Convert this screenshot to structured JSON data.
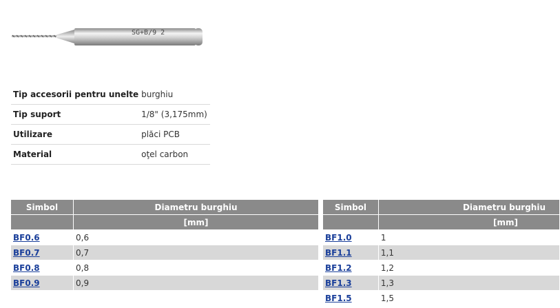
{
  "product": {
    "image_icon": "drill-bit-image",
    "image_engraving": "SG+B/9 2"
  },
  "specs": [
    {
      "label": "Tip accesorii pentru unelte",
      "value": "burghiu"
    },
    {
      "label": "Tip suport",
      "value": "1/8\" (3,175mm)"
    },
    {
      "label": "Utilizare",
      "value": "plăci PCB"
    },
    {
      "label": "Material",
      "value": "oţel carbon"
    }
  ],
  "table_left": {
    "col_symbol": "Simbol",
    "col_diameter": "Diametru burghiu",
    "unit": "[mm]",
    "rows": [
      {
        "symbol": "BF0.6",
        "diameter": "0,6"
      },
      {
        "symbol": "BF0.7",
        "diameter": "0,7"
      },
      {
        "symbol": "BF0.8",
        "diameter": "0,8"
      },
      {
        "symbol": "BF0.9",
        "diameter": "0,9"
      }
    ]
  },
  "table_right": {
    "col_symbol": "Simbol",
    "col_diameter": "Diametru burghiu",
    "unit": "[mm]",
    "rows": [
      {
        "symbol": "BF1.0",
        "diameter": "1"
      },
      {
        "symbol": "BF1.1",
        "diameter": "1,1"
      },
      {
        "symbol": "BF1.2",
        "diameter": "1,2"
      },
      {
        "symbol": "BF1.3",
        "diameter": "1,3"
      },
      {
        "symbol": "BF1.5",
        "diameter": "1,5"
      }
    ]
  }
}
